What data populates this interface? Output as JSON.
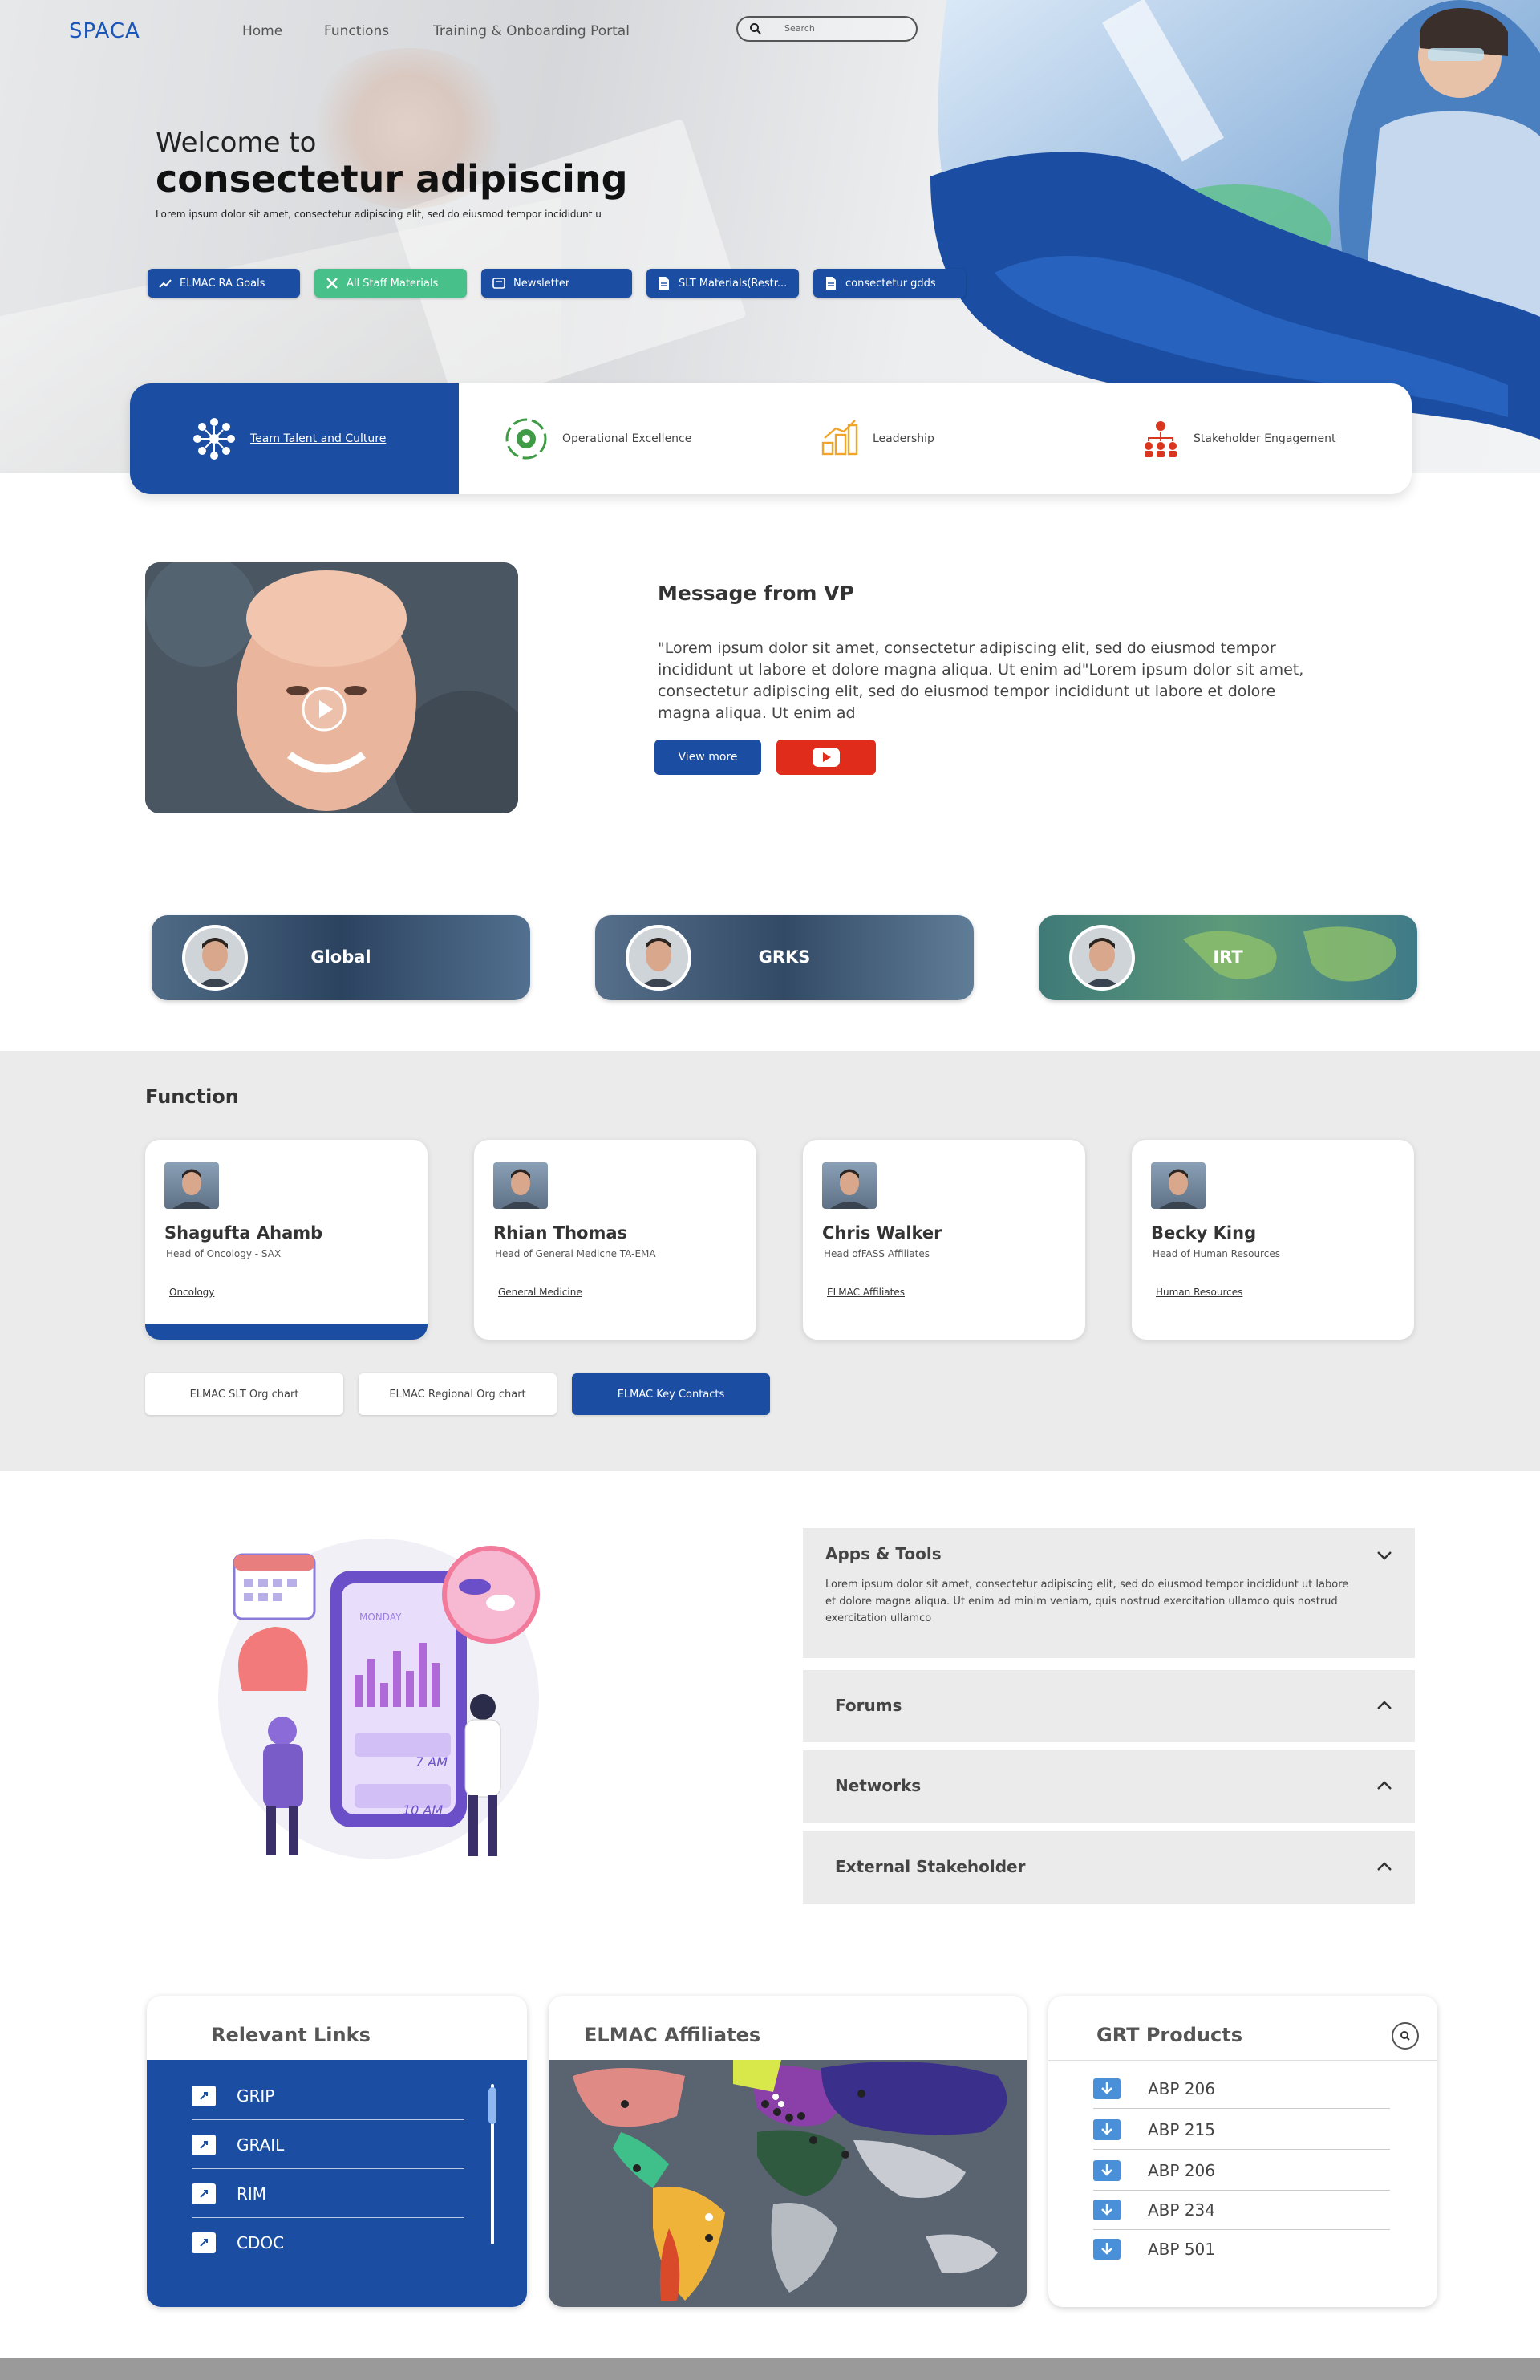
{
  "nav": {
    "logo": "SPACA",
    "links": [
      "Home",
      "Functions",
      "Training & Onboarding Portal"
    ],
    "search_placeholder": "Search"
  },
  "hero": {
    "welcome": "Welcome to",
    "headline": "consectetur adipiscing",
    "subtitle": "Lorem ipsum dolor sit amet, consectetur adipiscing elit, sed do eiusmod tempor incididunt u",
    "pills": [
      "ELMAC RA Goals",
      "All Staff Materials",
      "Newsletter",
      "SLT Materials(Restr...",
      "consectetur gdds"
    ]
  },
  "tabs": [
    "Team Talent and Culture",
    "Operational Excellence",
    "Leadership",
    "Stakeholder Engagement"
  ],
  "vp": {
    "title": "Message from VP",
    "text": "\"Lorem ipsum dolor sit amet, consectetur adipiscing elit, sed do eiusmod tempor incididunt ut labore et dolore magna aliqua. Ut enim ad\"Lorem ipsum dolor sit amet, consectetur adipiscing elit, sed do eiusmod tempor incididunt ut labore et dolore magna aliqua. Ut enim ad",
    "view_more": "View more"
  },
  "regions": [
    "Global",
    "GRKS",
    "IRT"
  ],
  "function": {
    "title": "Function",
    "people": [
      {
        "name": "Shagufta Ahamb",
        "role": "Head of Oncology - SAX",
        "link": "Oncology"
      },
      {
        "name": "Rhian Thomas",
        "role": "Head of General Medicne TA-EMA",
        "link": "General Medicine"
      },
      {
        "name": "Chris Walker",
        "role": "Head ofFASS Affiliates",
        "link": "ELMAC Affiliates"
      },
      {
        "name": "Becky King",
        "role": "Head of Human Resources",
        "link": "Human Resources"
      }
    ],
    "buttons": [
      "ELMAC SLT Org chart",
      "ELMAC Regional Org chart",
      "ELMAC  Key Contacts"
    ]
  },
  "illustration": {
    "day": "MONDAY",
    "time1": "7 AM",
    "time2": "10 AM"
  },
  "accordion": [
    {
      "title": "Apps & Tools",
      "body": "Lorem ipsum dolor sit amet, consectetur adipiscing elit, sed do eiusmod tempor incididunt ut labore et dolore magna aliqua. Ut enim ad minim veniam, quis nostrud exercitation ullamco quis nostrud exercitation ullamco"
    },
    {
      "title": "Forums"
    },
    {
      "title": "Networks"
    },
    {
      "title": "External Stakeholder"
    }
  ],
  "relevant_links": {
    "title": "Relevant Links",
    "items": [
      "GRIP",
      "GRAIL",
      "RIM",
      "CDOC"
    ]
  },
  "affiliates": {
    "title": "ELMAC Affiliates"
  },
  "products": {
    "title": "GRT Products",
    "items": [
      "ABP 206",
      "ABP 215",
      "ABP 206",
      "ABP 234",
      "ABP 501"
    ]
  },
  "colors": {
    "primary": "#1b4ea3",
    "green": "#48c08a",
    "red": "#e02d1b",
    "grey": "#ebebeb"
  }
}
